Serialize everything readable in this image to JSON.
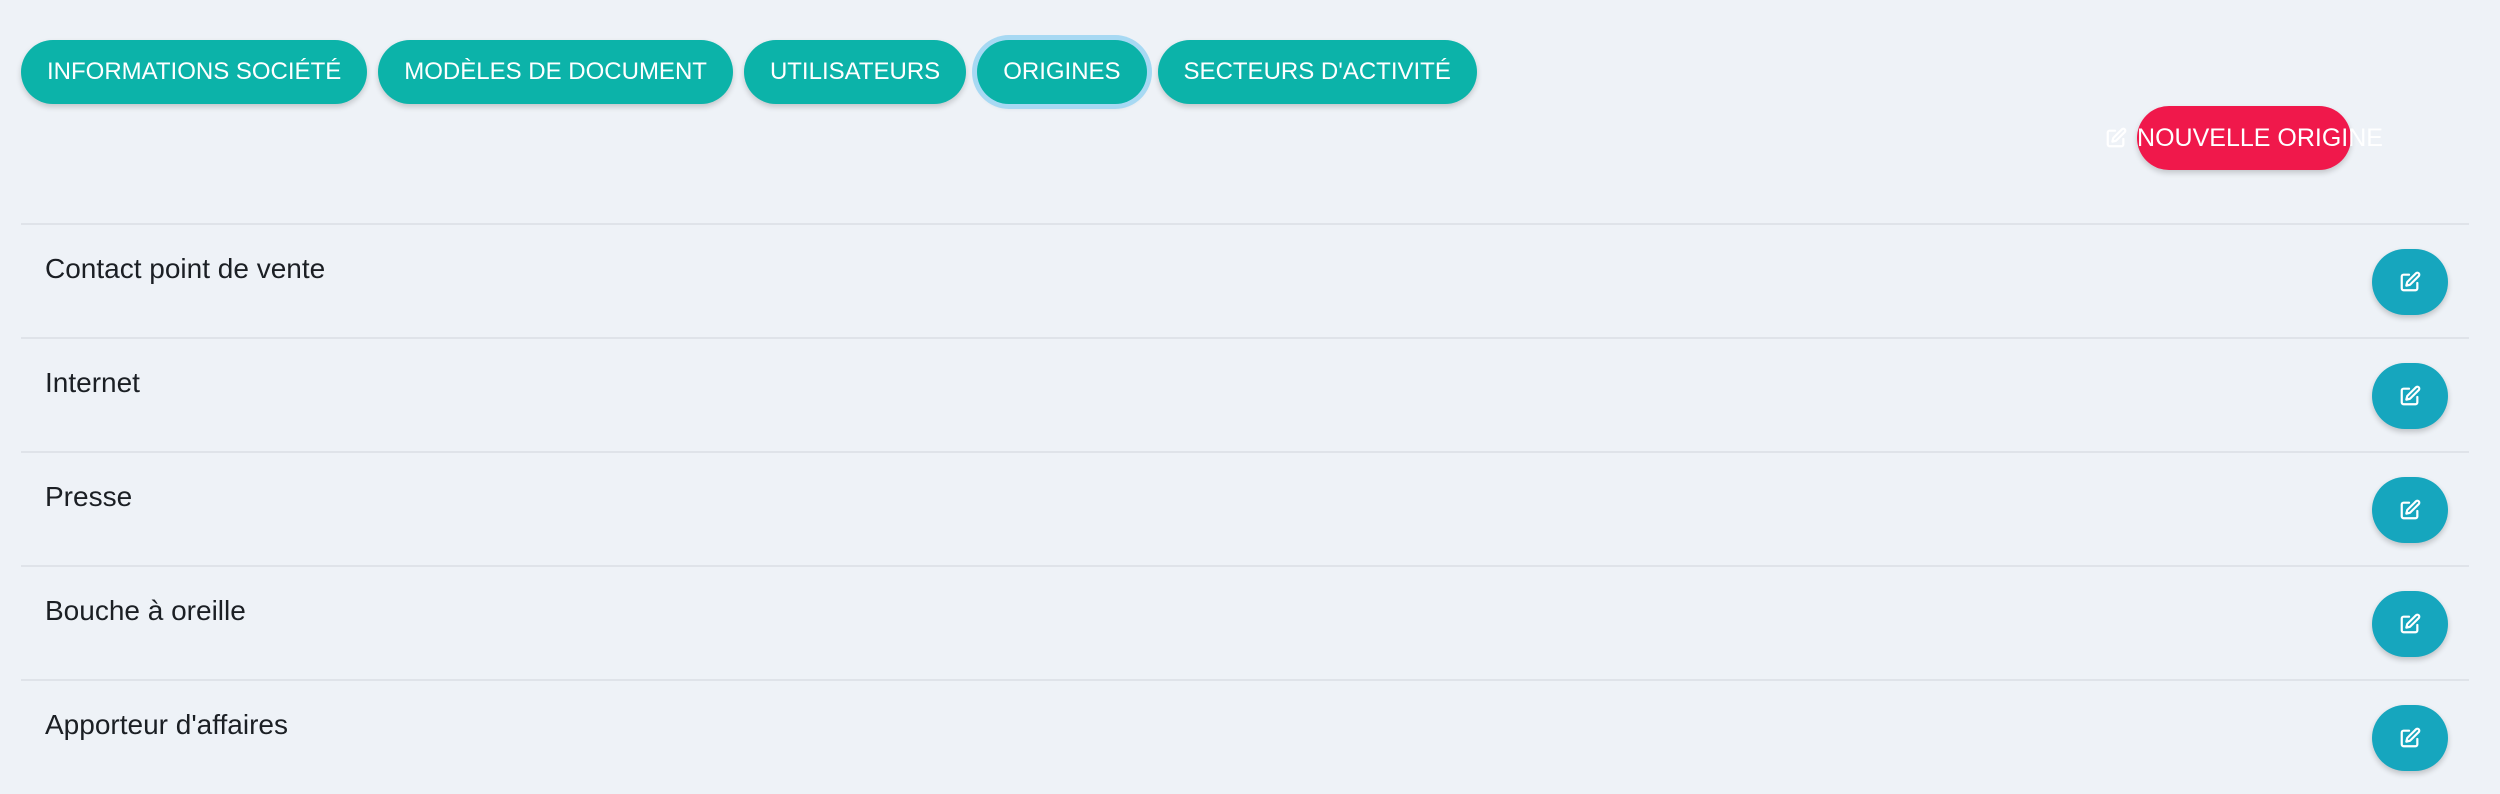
{
  "tabs": [
    {
      "label": "INFORMATIONS SOCIÉTÉ",
      "active": false
    },
    {
      "label": "MODÈLES DE DOCUMENT",
      "active": false
    },
    {
      "label": "UTILISATEURS",
      "active": false
    },
    {
      "label": "ORIGINES",
      "active": true
    },
    {
      "label": "SECTEURS D'ACTIVITÉ",
      "active": false
    }
  ],
  "new_button": {
    "label": "NOUVELLE ORIGINE",
    "icon": "edit-icon"
  },
  "origins": [
    {
      "label": "Contact point de vente",
      "icon": "edit-icon"
    },
    {
      "label": "Internet",
      "icon": "edit-icon"
    },
    {
      "label": "Presse",
      "icon": "edit-icon"
    },
    {
      "label": "Bouche à oreille",
      "icon": "edit-icon"
    },
    {
      "label": "Apporteur d'affaires",
      "icon": "edit-icon"
    }
  ],
  "colors": {
    "tab_bg": "#0cb3a9",
    "active_ring": "#a7d9f3",
    "new_button_bg": "#f0184b",
    "edit_button_bg": "#16a6be",
    "page_bg": "#eef2f7"
  }
}
